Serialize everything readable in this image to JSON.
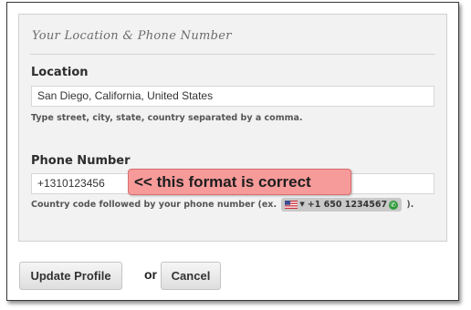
{
  "section": {
    "title": "Your Location & Phone Number"
  },
  "location": {
    "label": "Location",
    "value": "San Diego, California, United States",
    "hint": "Type street, city, state, country separated by a comma."
  },
  "phone": {
    "label": "Phone Number",
    "value": "+1310123456",
    "hint_prefix": "Country code followed by your phone number (ex.",
    "example_number": "+1 650 1234567",
    "hint_suffix": ")."
  },
  "callout": {
    "text": "<< this format is correct",
    "color": "#f79a9a"
  },
  "actions": {
    "update_label": "Update Profile",
    "or_label": "or",
    "cancel_label": "Cancel"
  },
  "icons": {
    "flag": "us-flag-icon",
    "caret": "caret-down-icon",
    "phone": "phone-icon"
  }
}
